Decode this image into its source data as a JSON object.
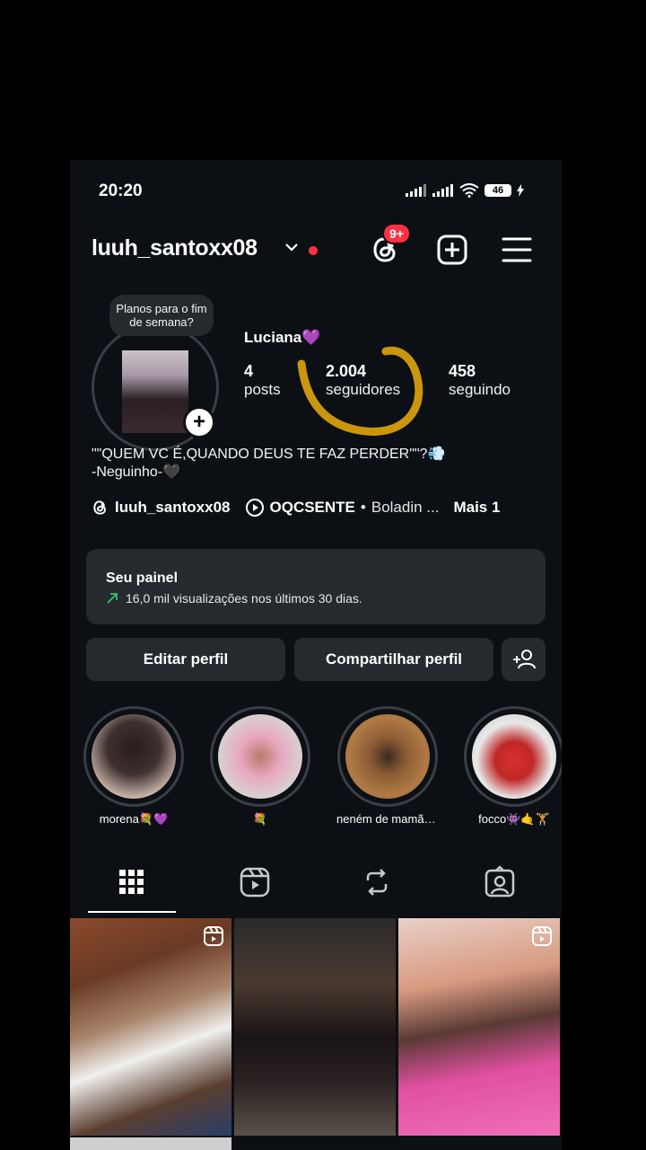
{
  "status_bar": {
    "time": "20:20",
    "battery": "46"
  },
  "header": {
    "username": "luuh_santoxx08",
    "notification_badge": "9+"
  },
  "profile": {
    "note": "Planos para o fim de semana?",
    "name": "Luciana💜",
    "stats": [
      {
        "value": "4",
        "label": "posts"
      },
      {
        "value": "2.004",
        "label": "seguidores"
      },
      {
        "value": "458",
        "label": "seguindo"
      }
    ],
    "bio_line1": "\"\"QUEM VC É,QUANDO DEUS TE FAZ PERDER\"\"?💨",
    "bio_line2": "-Neguinho-🖤",
    "threads_handle": "luuh_santoxx08",
    "music_artist": "OQCSENTE",
    "music_title": "Boladin ...",
    "more_links": "Mais 1"
  },
  "dashboard": {
    "title": "Seu painel",
    "subtitle": "16,0 mil visualizações nos últimos 30 dias."
  },
  "actions": {
    "edit": "Editar perfil",
    "share": "Compartilhar perfil"
  },
  "highlights": [
    {
      "label": "morena💐💜"
    },
    {
      "label": "💐"
    },
    {
      "label": "neném de mamãe ..."
    },
    {
      "label": "focco👾🤙🏋"
    }
  ],
  "colors": {
    "background": "#0c1014",
    "accent_red": "#ff3040",
    "panel": "#262a2f",
    "scribble": "#c9960c"
  },
  "icons": {
    "threads": "threads-icon",
    "new_post": "plus-square-icon",
    "menu": "hamburger-menu-icon"
  }
}
